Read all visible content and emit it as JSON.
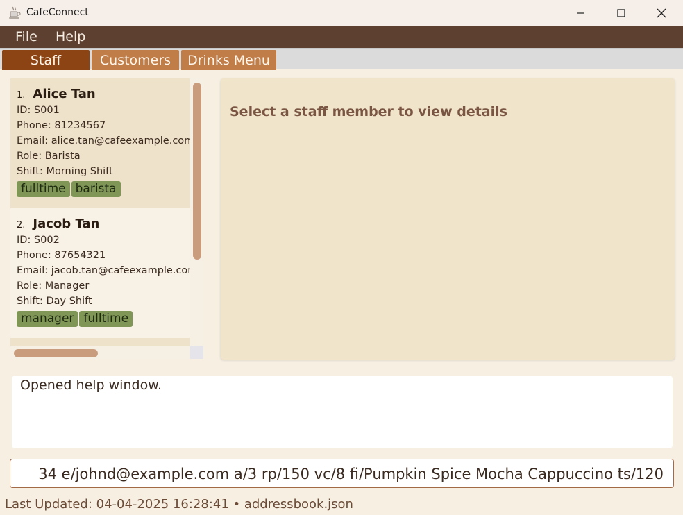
{
  "window": {
    "title": "CafeConnect"
  },
  "menu": {
    "items": [
      "File",
      "Help"
    ]
  },
  "tabs": [
    {
      "label": "Staff",
      "active": true
    },
    {
      "label": "Customers",
      "active": false
    },
    {
      "label": "Drinks Menu",
      "active": false
    }
  ],
  "staff_list": [
    {
      "index": "1.",
      "name": "Alice Tan",
      "id_line": "ID: S001",
      "phone_line": "Phone: 81234567",
      "email_line": "Email: alice.tan@cafeexample.com",
      "role_line": "Role: Barista",
      "shift_line": "Shift: Morning Shift",
      "tags": [
        "fulltime",
        "barista"
      ]
    },
    {
      "index": "2.",
      "name": "Jacob Tan",
      "id_line": "ID: S002",
      "phone_line": "Phone: 87654321",
      "email_line": "Email: jacob.tan@cafeexample.com",
      "role_line": "Role: Manager",
      "shift_line": "Shift: Day Shift",
      "tags": [
        "manager",
        "fulltime"
      ]
    }
  ],
  "details": {
    "placeholder": "Select a staff member to view details"
  },
  "result": {
    "text": "Opened help window."
  },
  "command": {
    "value": "34 e/johnd@example.com a/3 rp/150 vc/8 fi/Pumpkin Spice Mocha Cappuccino ts/120"
  },
  "status": {
    "text": "Last Updated: 04-04-2025 16:28:41 • addressbook.json"
  },
  "colors": {
    "menubar": "#5e4031",
    "tab_active": "#8c4415",
    "tab_inactive": "#c17d48",
    "tag": "#7f9657",
    "card_selected": "#efe2cb",
    "details_bg": "#f0e4cb"
  },
  "icons": [
    "coffee-cup-icon",
    "minimize-icon",
    "maximize-icon",
    "close-icon"
  ]
}
